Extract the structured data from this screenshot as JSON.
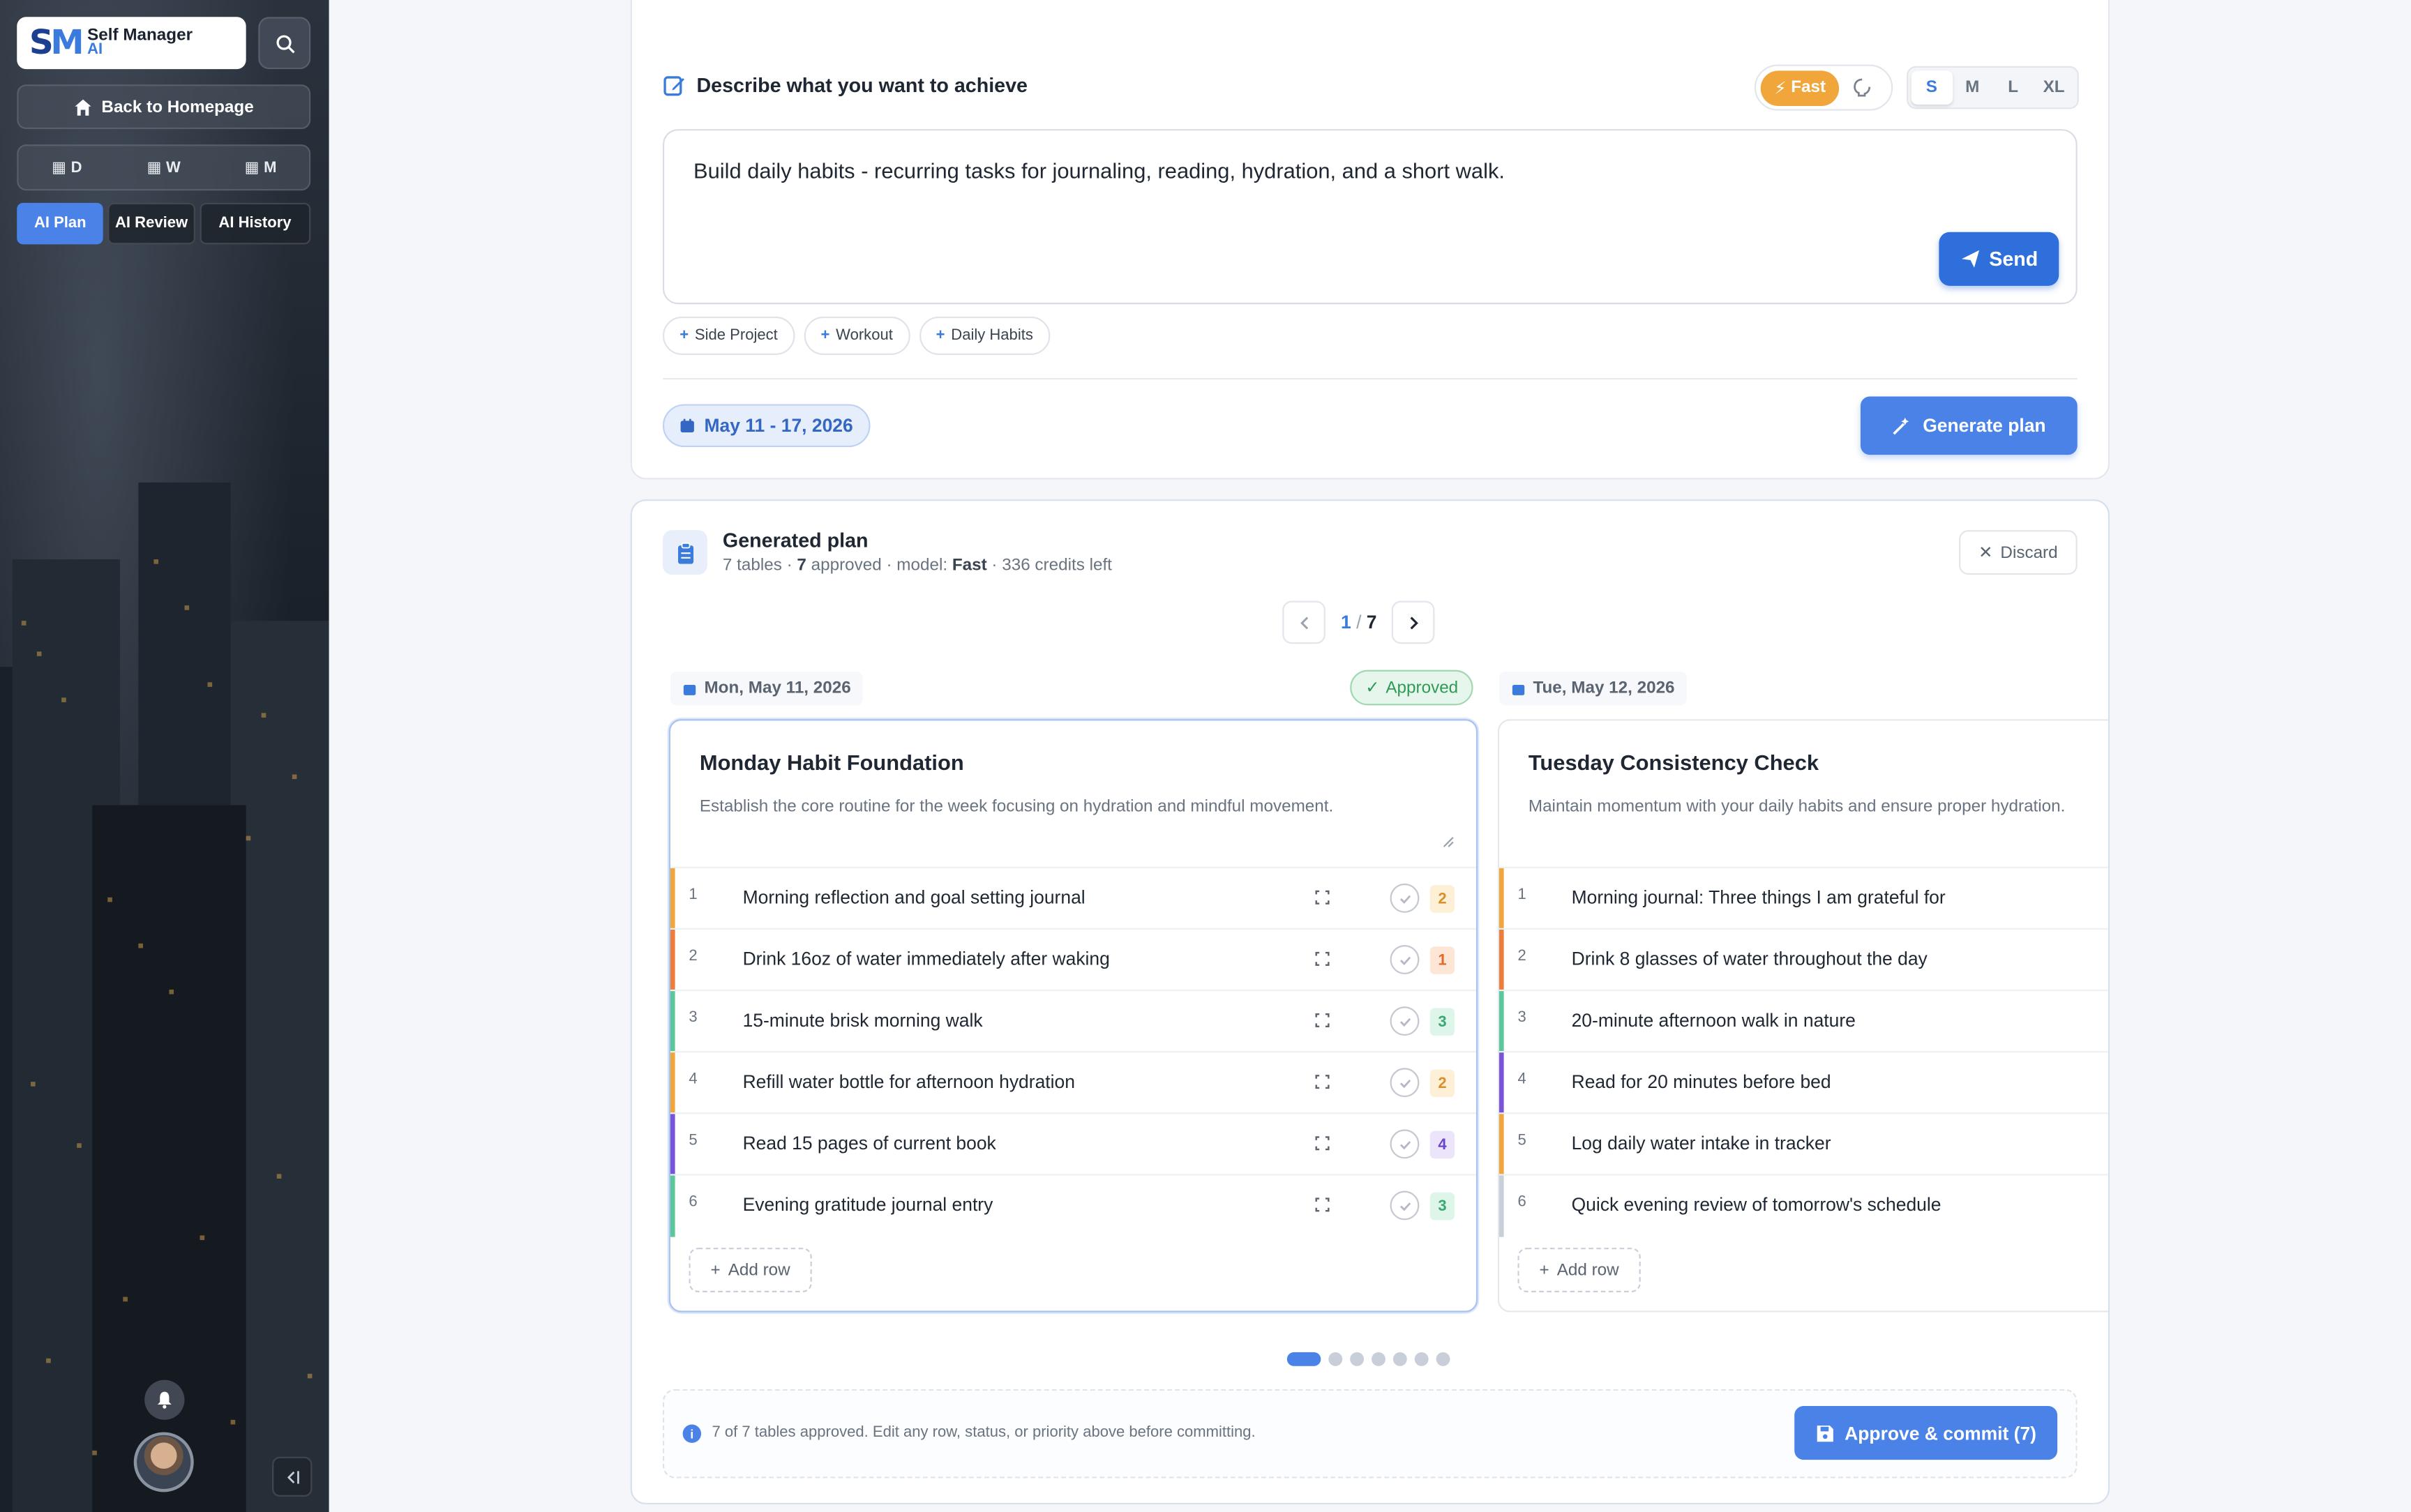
{
  "sidebar": {
    "logo_mark_a": "S",
    "logo_mark_b": "M",
    "logo_title": "Self Manager",
    "logo_sub": "AI",
    "back_label": "Back to Homepage",
    "views": [
      "D",
      "W",
      "M"
    ],
    "ai_tabs": [
      "AI Plan",
      "AI Review",
      "AI History"
    ]
  },
  "composer": {
    "title": "Describe what you want to achieve",
    "speed_label": "Fast",
    "sizes": [
      "S",
      "M",
      "L",
      "XL"
    ],
    "prompt": "Build daily habits - recurring tasks for journaling, reading, hydration, and a short walk.",
    "send_label": "Send",
    "chips": [
      "Side Project",
      "Workout",
      "Daily Habits"
    ],
    "date_range": "May 11 - 17, 2026",
    "generate_label": "Generate plan"
  },
  "plan": {
    "title": "Generated plan",
    "sub_tables": "7 tables · ",
    "sub_approved_count": "7",
    "sub_approved_word": " approved · model: ",
    "sub_model": "Fast",
    "sub_credits": " · 336 credits left",
    "discard_label": "Discard",
    "page_current": "1",
    "page_sep": " / ",
    "page_total": "7",
    "approved_label": "Approved",
    "add_row_label": "Add row",
    "commit_info": "7 of 7 tables approved. Edit any row, status, or priority above before committing.",
    "commit_label": "Approve & commit (7)",
    "days": [
      {
        "date": "Mon, May 11, 2026",
        "title": "Monday Habit Foundation",
        "description": "Establish the core routine for the week focusing on hydration and mindful movement.",
        "rows": [
          {
            "n": "1",
            "text": "Morning reflection and goal setting journal",
            "prio": "2",
            "color": "#f0a63b"
          },
          {
            "n": "2",
            "text": "Drink 16oz of water immediately after waking",
            "prio": "1",
            "color": "#ee7d3b"
          },
          {
            "n": "3",
            "text": "15-minute brisk morning walk",
            "prio": "3",
            "color": "#5cc79a"
          },
          {
            "n": "4",
            "text": "Refill water bottle for afternoon hydration",
            "prio": "2",
            "color": "#f0a63b"
          },
          {
            "n": "5",
            "text": "Read 15 pages of current book",
            "prio": "4",
            "color": "#7a54d8"
          },
          {
            "n": "6",
            "text": "Evening gratitude journal entry",
            "prio": "3",
            "color": "#5cc79a"
          }
        ]
      },
      {
        "date": "Tue, May 12, 2026",
        "title": "Tuesday Consistency Check",
        "description": "Maintain momentum with your daily habits and ensure proper hydration.",
        "rows": [
          {
            "n": "1",
            "text": "Morning journal: Three things I am grateful for",
            "color": "#f0a63b"
          },
          {
            "n": "2",
            "text": "Drink 8 glasses of water throughout the day",
            "color": "#ee7d3b"
          },
          {
            "n": "3",
            "text": "20-minute afternoon walk in nature",
            "color": "#5cc79a"
          },
          {
            "n": "4",
            "text": "Read for 20 minutes before bed",
            "color": "#7a54d8"
          },
          {
            "n": "5",
            "text": "Log daily water intake in tracker",
            "color": "#f0a63b"
          },
          {
            "n": "6",
            "text": "Quick evening review of tomorrow's schedule",
            "color": "#c9cfd8"
          }
        ]
      }
    ]
  },
  "prio_colors": {
    "1": {
      "bg": "#fde6d6",
      "fg": "#e0692a"
    },
    "2": {
      "bg": "#fdf0d6",
      "fg": "#d9902a"
    },
    "3": {
      "bg": "#def5ea",
      "fg": "#3aa872"
    },
    "4": {
      "bg": "#ebe4fa",
      "fg": "#6a45c9"
    }
  },
  "accent": "#4a82e8"
}
